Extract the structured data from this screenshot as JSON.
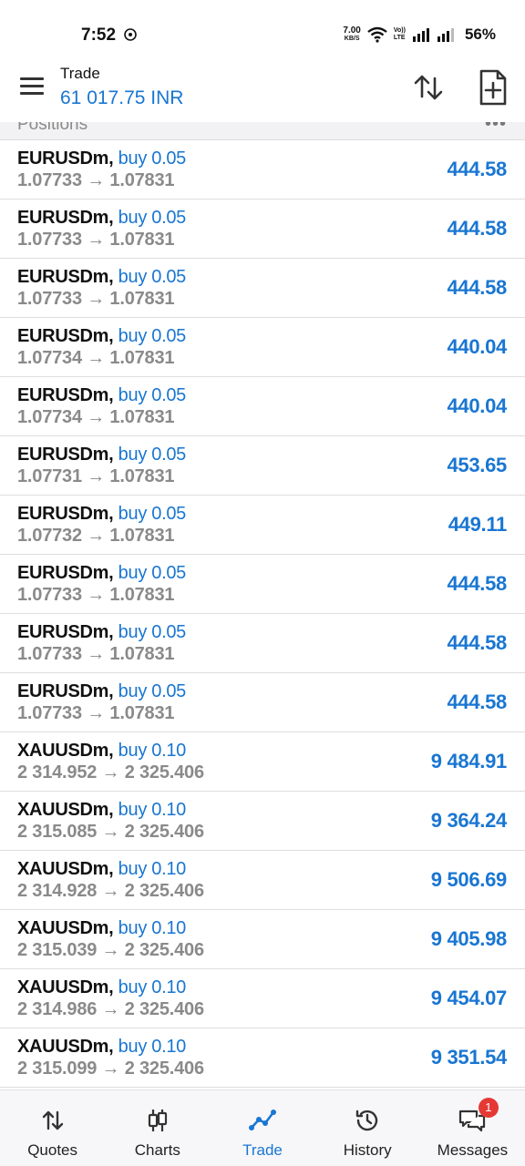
{
  "status_bar": {
    "time": "7:52",
    "net_speed": "7.00",
    "net_unit": "KB/S",
    "volte_top": "Vo))",
    "volte_bottom": "LTE",
    "battery": "56%"
  },
  "header": {
    "title": "Trade",
    "balance": "61 017.75 INR",
    "accent_color": "#1976d2"
  },
  "section": {
    "title": "Positions",
    "more_icon": "more-horizontal-icon"
  },
  "positions": [
    {
      "symbol": "EURUSDm,",
      "side": "buy 0.05",
      "prices": "1.07733 → 1.07831",
      "profit": "444.58"
    },
    {
      "symbol": "EURUSDm,",
      "side": "buy 0.05",
      "prices": "1.07733 → 1.07831",
      "profit": "444.58"
    },
    {
      "symbol": "EURUSDm,",
      "side": "buy 0.05",
      "prices": "1.07733 → 1.07831",
      "profit": "444.58"
    },
    {
      "symbol": "EURUSDm,",
      "side": "buy 0.05",
      "prices": "1.07734 → 1.07831",
      "profit": "440.04"
    },
    {
      "symbol": "EURUSDm,",
      "side": "buy 0.05",
      "prices": "1.07734 → 1.07831",
      "profit": "440.04"
    },
    {
      "symbol": "EURUSDm,",
      "side": "buy 0.05",
      "prices": "1.07731 → 1.07831",
      "profit": "453.65"
    },
    {
      "symbol": "EURUSDm,",
      "side": "buy 0.05",
      "prices": "1.07732 → 1.07831",
      "profit": "449.11"
    },
    {
      "symbol": "EURUSDm,",
      "side": "buy 0.05",
      "prices": "1.07733 → 1.07831",
      "profit": "444.58"
    },
    {
      "symbol": "EURUSDm,",
      "side": "buy 0.05",
      "prices": "1.07733 → 1.07831",
      "profit": "444.58"
    },
    {
      "symbol": "EURUSDm,",
      "side": "buy 0.05",
      "prices": "1.07733 → 1.07831",
      "profit": "444.58"
    },
    {
      "symbol": "XAUUSDm,",
      "side": "buy 0.10",
      "prices": "2 314.952 → 2 325.406",
      "profit": "9 484.91"
    },
    {
      "symbol": "XAUUSDm,",
      "side": "buy 0.10",
      "prices": "2 315.085 → 2 325.406",
      "profit": "9 364.24"
    },
    {
      "symbol": "XAUUSDm,",
      "side": "buy 0.10",
      "prices": "2 314.928 → 2 325.406",
      "profit": "9 506.69"
    },
    {
      "symbol": "XAUUSDm,",
      "side": "buy 0.10",
      "prices": "2 315.039 → 2 325.406",
      "profit": "9 405.98"
    },
    {
      "symbol": "XAUUSDm,",
      "side": "buy 0.10",
      "prices": "2 314.986 → 2 325.406",
      "profit": "9 454.07"
    },
    {
      "symbol": "XAUUSDm,",
      "side": "buy 0.10",
      "prices": "2 315.099 → 2 325.406",
      "profit": "9 351.54"
    }
  ],
  "bottom_nav": [
    {
      "label": "Quotes",
      "icon": "quotes-arrows-icon"
    },
    {
      "label": "Charts",
      "icon": "candlestick-icon"
    },
    {
      "label": "Trade",
      "icon": "trade-line-icon",
      "active": true
    },
    {
      "label": "History",
      "icon": "history-clock-icon"
    },
    {
      "label": "Messages",
      "icon": "messages-icon",
      "badge": "1"
    }
  ]
}
